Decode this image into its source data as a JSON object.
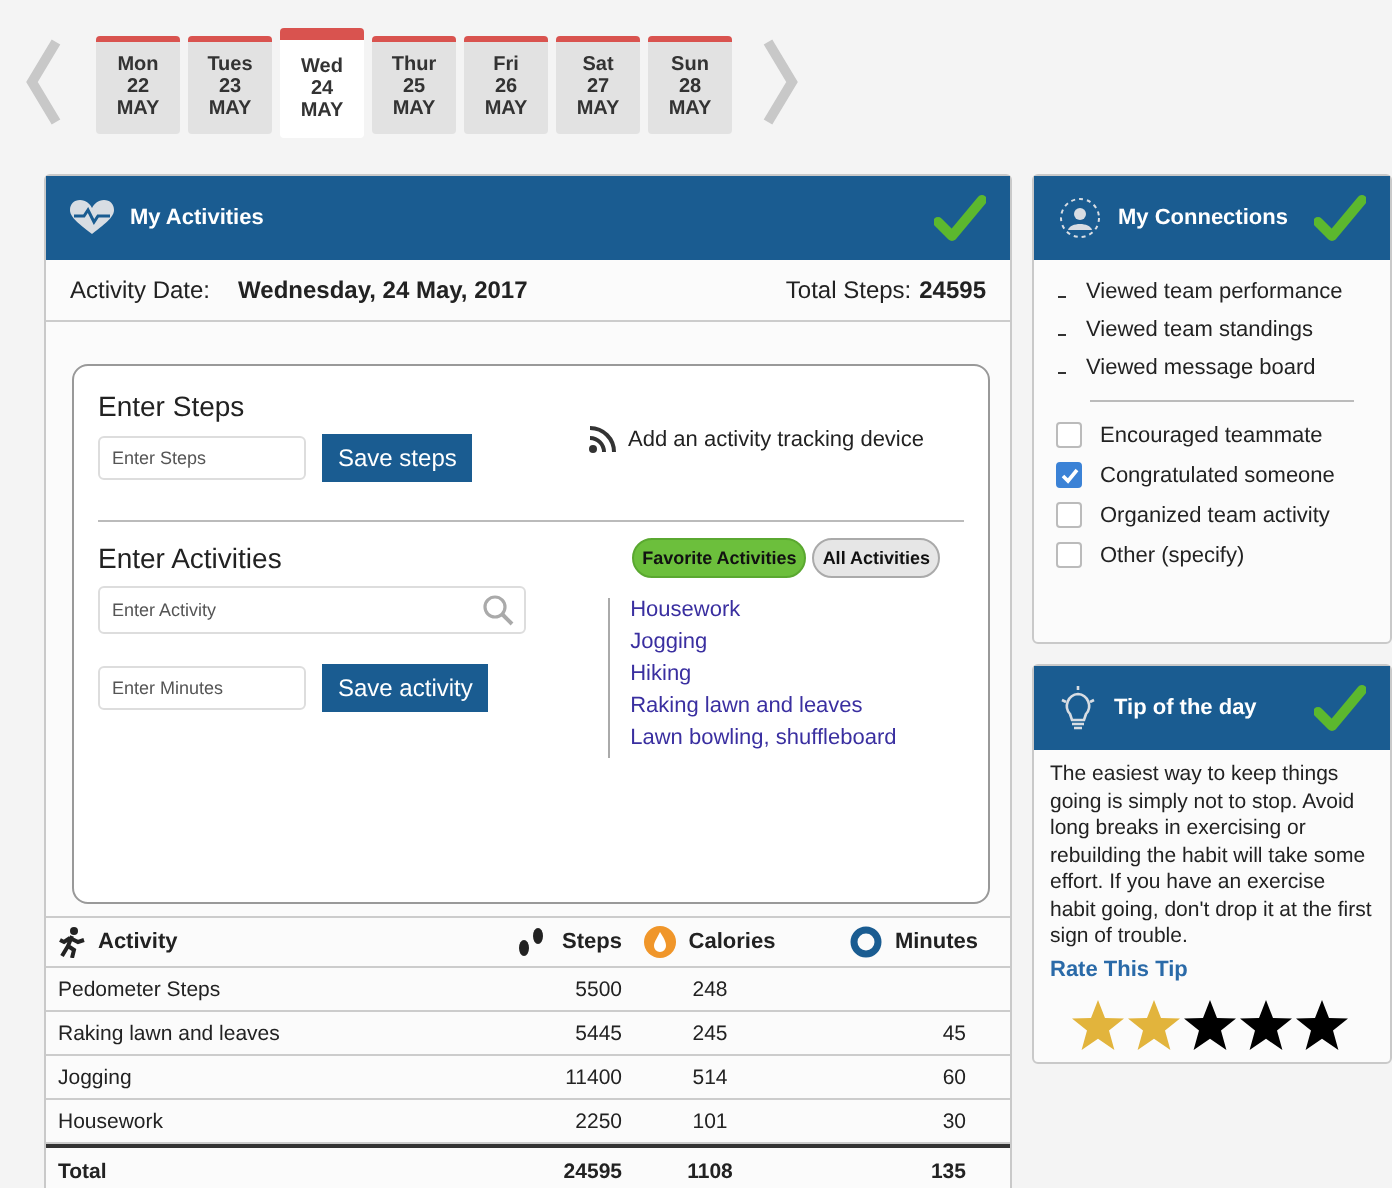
{
  "days": [
    {
      "weekday": "Mon",
      "day": "22",
      "month": "MAY",
      "selected": false
    },
    {
      "weekday": "Tues",
      "day": "23",
      "month": "MAY",
      "selected": false
    },
    {
      "weekday": "Wed",
      "day": "24",
      "month": "MAY",
      "selected": true
    },
    {
      "weekday": "Thur",
      "day": "25",
      "month": "MAY",
      "selected": false
    },
    {
      "weekday": "Fri",
      "day": "26",
      "month": "MAY",
      "selected": false
    },
    {
      "weekday": "Sat",
      "day": "27",
      "month": "MAY",
      "selected": false
    },
    {
      "weekday": "Sun",
      "day": "28",
      "month": "MAY",
      "selected": false
    }
  ],
  "activities": {
    "title": "My Activities",
    "date_label": "Activity Date:",
    "date": "Wednesday, 24 May, 2017",
    "total_label": "Total Steps:",
    "total": "24595",
    "steps": {
      "heading": "Enter Steps",
      "placeholder": "Enter Steps",
      "button": "Save steps"
    },
    "device_link": "Add an activity tracking device",
    "entry": {
      "heading": "Enter Activities",
      "activity_placeholder": "Enter Activity",
      "minutes_placeholder": "Enter Minutes",
      "button": "Save activity"
    },
    "filters": [
      {
        "label": "Favorite Activities",
        "selected": true
      },
      {
        "label": "All Activities",
        "selected": false
      }
    ],
    "favorites": [
      "Housework",
      "Jogging",
      "Hiking",
      "Raking lawn and leaves",
      "Lawn bowling, shuffleboard"
    ],
    "table": {
      "columns": [
        "Activity",
        "Steps",
        "Calories",
        "Minutes"
      ],
      "rows": [
        [
          "Pedometer Steps",
          "5500",
          "248",
          ""
        ],
        [
          "Raking lawn and leaves",
          "5445",
          "245",
          "45"
        ],
        [
          "Jogging",
          "11400",
          "514",
          "60"
        ],
        [
          "Housework",
          "2250",
          "101",
          "30"
        ]
      ],
      "total": [
        "Total",
        "24595",
        "1108",
        "135"
      ]
    }
  },
  "connections": {
    "title": "My Connections",
    "viewed": [
      "Viewed team performance",
      "Viewed team standings",
      "Viewed message board"
    ],
    "actions": [
      {
        "label": "Encouraged teammate",
        "checked": false
      },
      {
        "label": "Congratulated someone",
        "checked": true
      },
      {
        "label": "Organized team activity",
        "checked": false
      },
      {
        "label": "Other (specify)",
        "checked": false
      }
    ]
  },
  "tip": {
    "title": "Tip of the day",
    "text": "The easiest way to keep things going is simply not to stop. Avoid long breaks in exercising or rebuilding the habit will take some effort. If you have an exercise habit going, don't drop it at the first sign of trouble.",
    "rate_label": "Rate This Tip",
    "stars": 2
  }
}
